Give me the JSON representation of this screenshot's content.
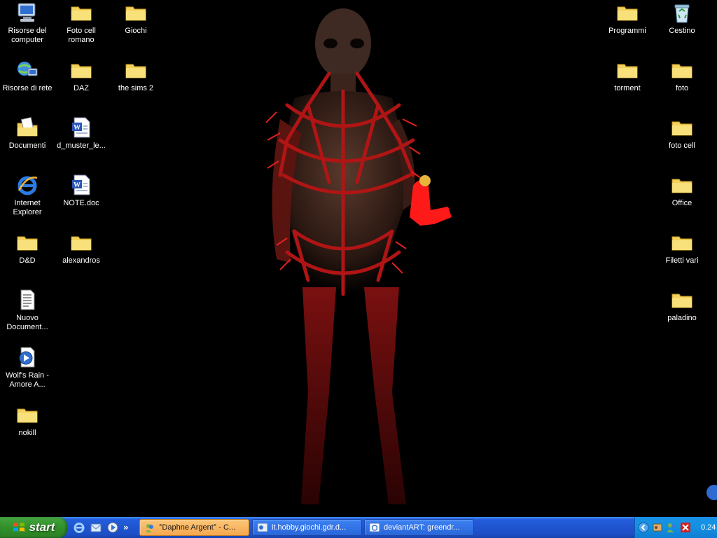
{
  "desktop": {
    "left_icons": [
      {
        "label": "Risorse del computer",
        "icon": "my-computer-icon"
      },
      {
        "label": "Foto cell romano",
        "icon": "folder-icon"
      },
      {
        "label": "Giochi",
        "icon": "folder-icon"
      },
      {
        "label": "Risorse di rete",
        "icon": "network-places-icon"
      },
      {
        "label": "DAZ",
        "icon": "folder-icon"
      },
      {
        "label": "the sims 2",
        "icon": "folder-icon"
      },
      {
        "label": "Documenti",
        "icon": "my-documents-icon"
      },
      {
        "label": "d_muster_le...",
        "icon": "word-document-icon"
      },
      {
        "label": "Internet Explorer",
        "icon": "internet-explorer-icon"
      },
      {
        "label": "NOTE.doc",
        "icon": "word-document-icon"
      },
      {
        "label": "D&D",
        "icon": "folder-icon"
      },
      {
        "label": "alexandros",
        "icon": "folder-icon"
      },
      {
        "label": "Nuovo Document...",
        "icon": "text-document-icon"
      },
      {
        "label": "Wolf's Rain - Amore A...",
        "icon": "media-file-icon"
      },
      {
        "label": "nokill",
        "icon": "folder-icon"
      }
    ],
    "right_icons": [
      {
        "label": "Programmi",
        "icon": "folder-icon"
      },
      {
        "label": "Cestino",
        "icon": "recycle-bin-icon"
      },
      {
        "label": "torment",
        "icon": "folder-icon"
      },
      {
        "label": "foto",
        "icon": "folder-icon"
      },
      {
        "label": "foto cell",
        "icon": "folder-icon"
      },
      {
        "label": "Office",
        "icon": "folder-icon"
      },
      {
        "label": "Filetti vari",
        "icon": "folder-icon"
      },
      {
        "label": "paladino",
        "icon": "folder-icon"
      }
    ]
  },
  "taskbar": {
    "start_label": "start",
    "quick_launch_more": "»",
    "tasks": [
      {
        "label": "°Daphne Argent° - C...",
        "active": true,
        "icon": "messenger-icon"
      },
      {
        "label": "it.hobby.giochi.gdr.d...",
        "active": false,
        "icon": "newsgroup-icon"
      },
      {
        "label": "deviantART: greendr...",
        "active": false,
        "icon": "browser-window-icon"
      }
    ],
    "clock": "0.24"
  },
  "colors": {
    "taskbar_blue": "#245edb",
    "start_green": "#3c9c35",
    "tray_blue": "#1493e2",
    "active_task": "#f6a84f",
    "folder_yellow": "#f3d15a"
  }
}
